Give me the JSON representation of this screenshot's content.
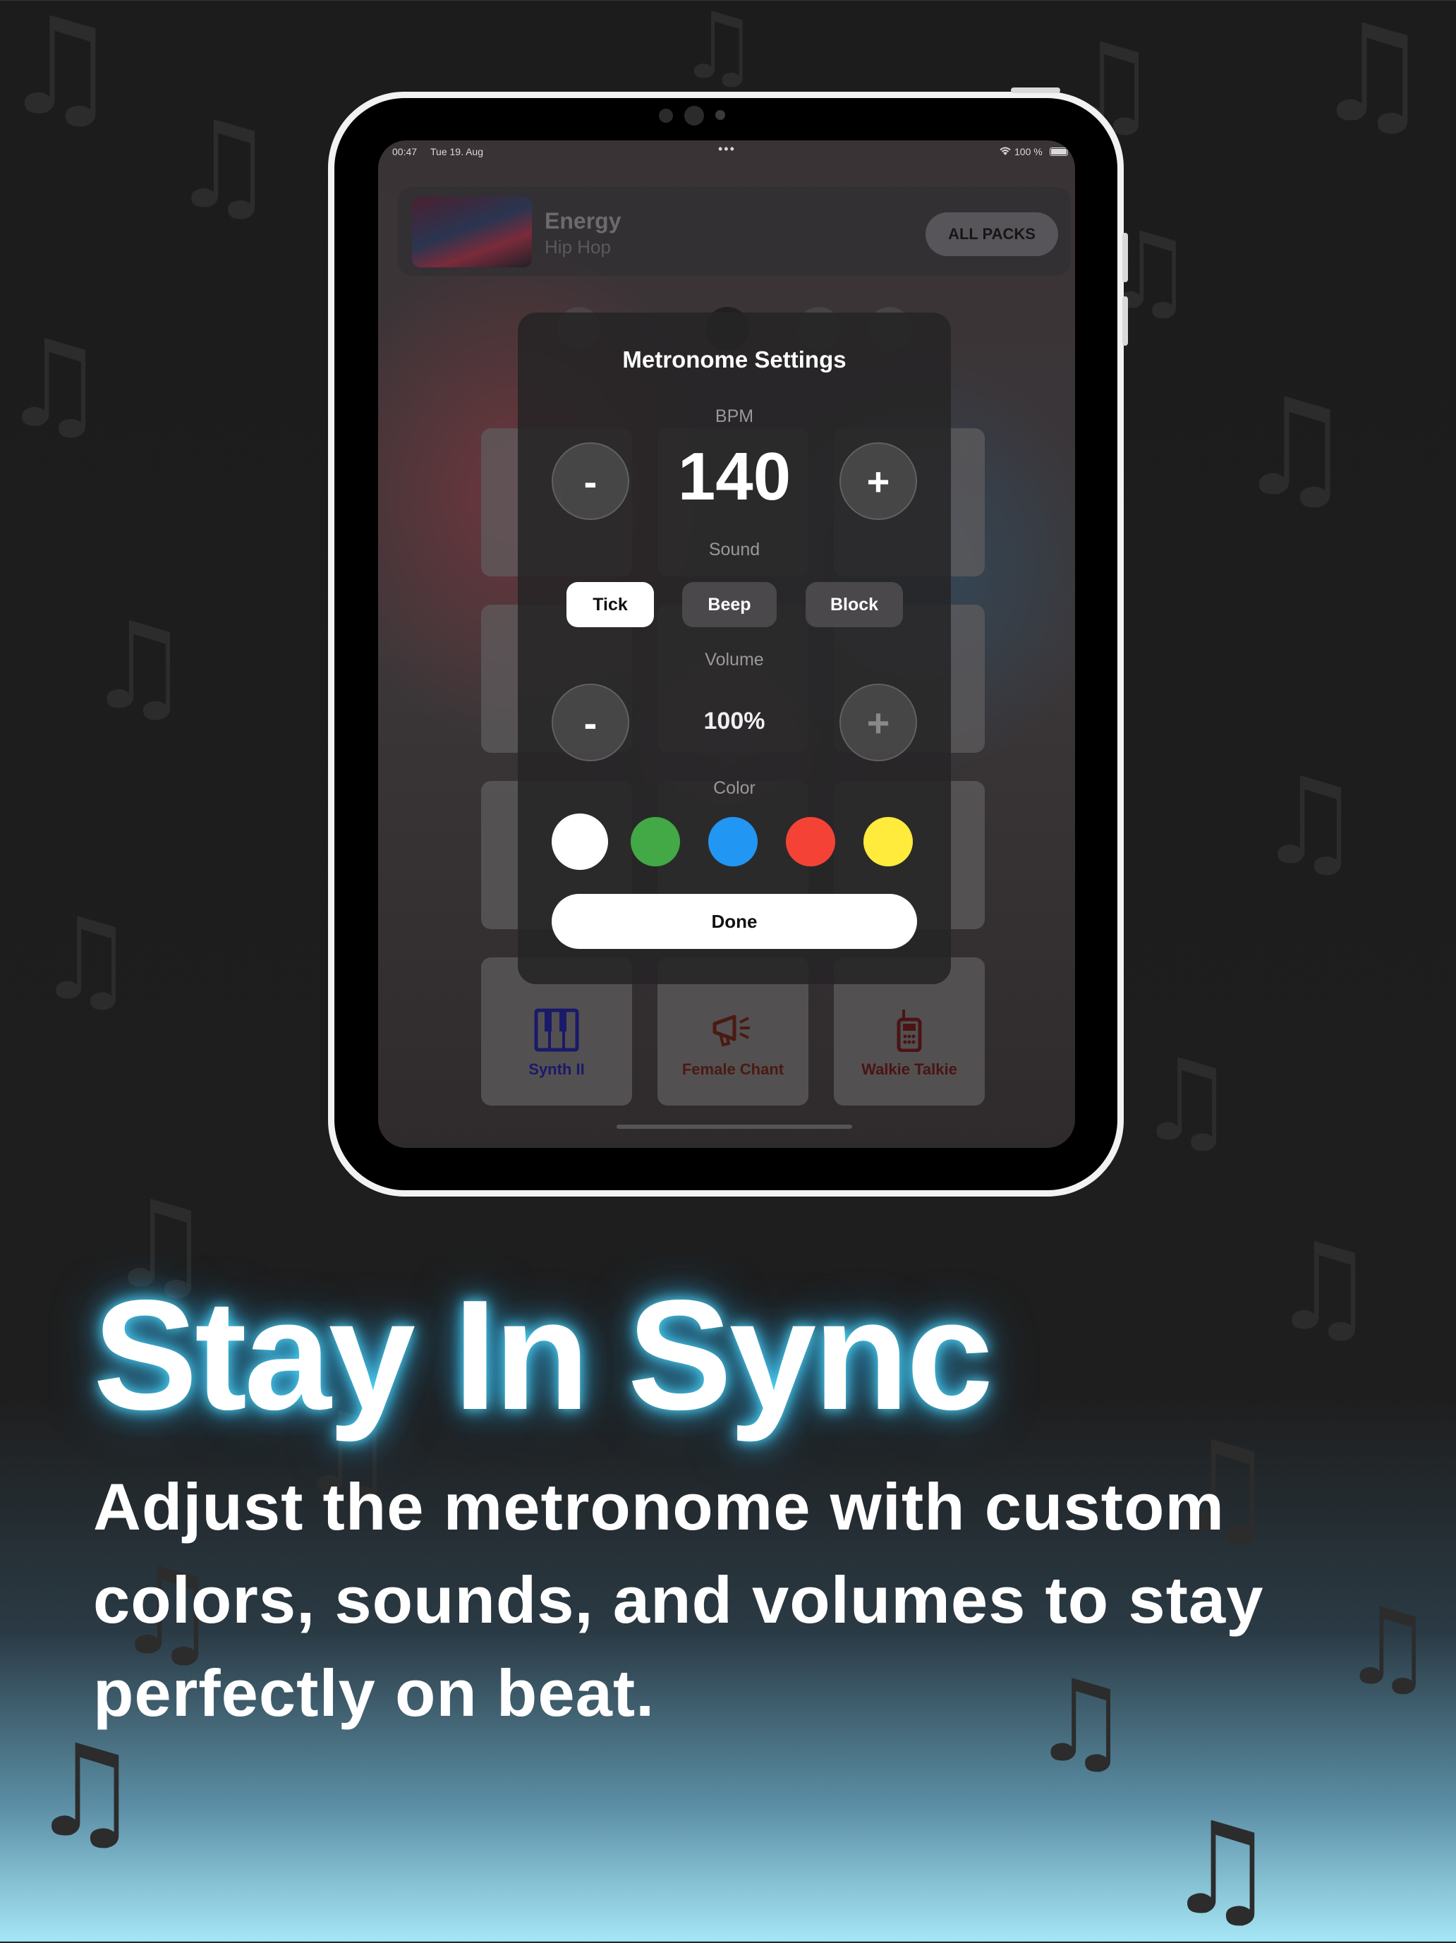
{
  "status_bar": {
    "time": "00:47",
    "date": "Tue 19. Aug",
    "dots": "•••",
    "battery": "100 %"
  },
  "now_playing": {
    "title": "Energy",
    "subtitle": "Hip Hop",
    "all_packs_label": "ALL PACKS"
  },
  "pads": [
    {
      "label": "Synth II",
      "icon": "piano-icon",
      "color": "#1a1a6a"
    },
    {
      "label": "Female Chant",
      "icon": "megaphone-icon",
      "color": "#4a1a12"
    },
    {
      "label": "Walkie Talkie",
      "icon": "walkie-talkie-icon",
      "color": "#4a1414"
    }
  ],
  "modal": {
    "title": "Metronome Settings",
    "bpm_label": "BPM",
    "bpm_value": "140",
    "minus": "-",
    "plus": "+",
    "sound_label": "Sound",
    "sounds": [
      {
        "label": "Tick",
        "selected": true
      },
      {
        "label": "Beep",
        "selected": false
      },
      {
        "label": "Block",
        "selected": false
      }
    ],
    "volume_label": "Volume",
    "volume_value": "100%",
    "color_label": "Color",
    "colors": [
      "#ffffff",
      "#43a846",
      "#2196f3",
      "#f44336",
      "#ffeb3b"
    ],
    "done_label": "Done"
  },
  "headline": "Stay In Sync",
  "subcopy": "Adjust the metronome with custom colors, sounds, and volumes to stay perfectly on beat."
}
